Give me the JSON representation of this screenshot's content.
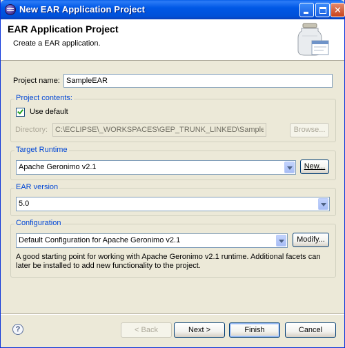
{
  "window": {
    "title": "New EAR Application Project"
  },
  "banner": {
    "title": "EAR Application Project",
    "description": "Create a EAR application."
  },
  "project_name": {
    "label": "Project name:",
    "value": "SampleEAR"
  },
  "project_contents": {
    "group_title": "Project contents:",
    "use_default_label": "Use default",
    "use_default_checked": true,
    "directory_label": "Directory:",
    "directory_value": "C:\\ECLIPSE\\_WORKSPACES\\GEP_TRUNK_LINKED\\SampleEAR",
    "browse_label": "Browse..."
  },
  "target_runtime": {
    "group_title": "Target Runtime",
    "selected": "Apache Geronimo v2.1",
    "new_label": "New..."
  },
  "ear_version": {
    "group_title": "EAR version",
    "selected": "5.0"
  },
  "configuration": {
    "group_title": "Configuration",
    "selected": "Default Configuration for Apache Geronimo v2.1",
    "modify_label": "Modify...",
    "description_line1": "A good starting point for working with Apache Geronimo v2.1 runtime. Additional facets can",
    "description_line2": "later be installed to add new functionality to the project."
  },
  "footer": {
    "back_label": "< Back",
    "next_label": "Next >",
    "finish_label": "Finish",
    "cancel_label": "Cancel",
    "help_glyph": "?"
  },
  "icons": {
    "window_icon": "eclipse-icon",
    "banner_art": "ear-jar-wizard-icon",
    "help": "help-icon"
  },
  "colors": {
    "titlebar": "#0058e6",
    "dialog_bg": "#ece9d8",
    "group_title": "#0046d5"
  }
}
